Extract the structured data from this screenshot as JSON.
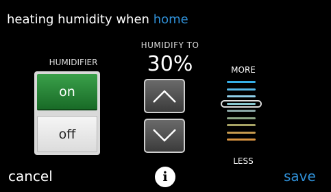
{
  "header": {
    "title_prefix": "heating humidity when",
    "mode": "home"
  },
  "humidifier": {
    "label": "HUMIDIFIER",
    "on_label": "on",
    "off_label": "off",
    "selected": "on"
  },
  "humidify_to": {
    "label": "HUMIDIFY TO",
    "value": "30%",
    "up_icon": "chevron-up-icon",
    "down_icon": "chevron-down-icon"
  },
  "scale": {
    "more_label": "MORE",
    "less_label": "LESS",
    "levels": [
      "#35aee6",
      "#55b8e8",
      "#8fd0ea",
      "#88c6cf",
      "#8ba7a7",
      "#8ea887",
      "#a6a264",
      "#c69a4e",
      "#d99440"
    ],
    "selected_level_index": 3
  },
  "footer": {
    "cancel_label": "cancel",
    "info_label": "i",
    "save_label": "save"
  },
  "colors": {
    "accent": "#2f8fd6",
    "on_green": "#2c8a3a",
    "background": "#000000"
  }
}
